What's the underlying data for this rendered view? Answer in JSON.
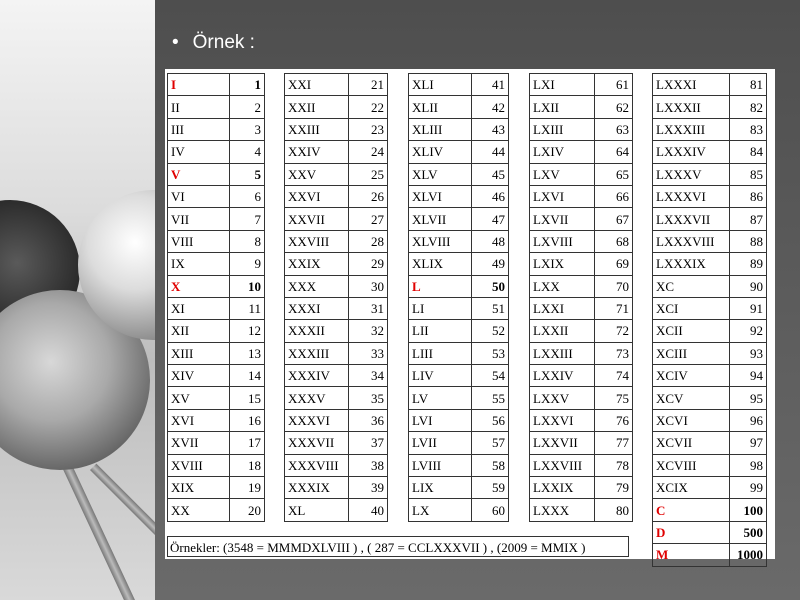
{
  "slide": {
    "bullet": "•",
    "heading": "Örnek :"
  },
  "groups": [
    {
      "rows": [
        [
          "I",
          "1"
        ],
        [
          "II",
          "2"
        ],
        [
          "III",
          "3"
        ],
        [
          "IV",
          "4"
        ],
        [
          "V",
          "5"
        ],
        [
          "VI",
          "6"
        ],
        [
          "VII",
          "7"
        ],
        [
          "VIII",
          "8"
        ],
        [
          "IX",
          "9"
        ],
        [
          "X",
          "10"
        ],
        [
          "XI",
          "11"
        ],
        [
          "XII",
          "12"
        ],
        [
          "XIII",
          "13"
        ],
        [
          "XIV",
          "14"
        ],
        [
          "XV",
          "15"
        ],
        [
          "XVI",
          "16"
        ],
        [
          "XVII",
          "17"
        ],
        [
          "XVIII",
          "18"
        ],
        [
          "XIX",
          "19"
        ],
        [
          "XX",
          "20"
        ]
      ]
    },
    {
      "rows": [
        [
          "XXI",
          "21"
        ],
        [
          "XXII",
          "22"
        ],
        [
          "XXIII",
          "23"
        ],
        [
          "XXIV",
          "24"
        ],
        [
          "XXV",
          "25"
        ],
        [
          "XXVI",
          "26"
        ],
        [
          "XXVII",
          "27"
        ],
        [
          "XXVIII",
          "28"
        ],
        [
          "XXIX",
          "29"
        ],
        [
          "XXX",
          "30"
        ],
        [
          "XXXI",
          "31"
        ],
        [
          "XXXII",
          "32"
        ],
        [
          "XXXIII",
          "33"
        ],
        [
          "XXXIV",
          "34"
        ],
        [
          "XXXV",
          "35"
        ],
        [
          "XXXVI",
          "36"
        ],
        [
          "XXXVII",
          "37"
        ],
        [
          "XXXVIII",
          "38"
        ],
        [
          "XXXIX",
          "39"
        ],
        [
          "XL",
          "40"
        ]
      ]
    },
    {
      "rows": [
        [
          "XLI",
          "41"
        ],
        [
          "XLII",
          "42"
        ],
        [
          "XLIII",
          "43"
        ],
        [
          "XLIV",
          "44"
        ],
        [
          "XLV",
          "45"
        ],
        [
          "XLVI",
          "46"
        ],
        [
          "XLVII",
          "47"
        ],
        [
          "XLVIII",
          "48"
        ],
        [
          "XLIX",
          "49"
        ],
        [
          "L",
          "50"
        ],
        [
          "LI",
          "51"
        ],
        [
          "LII",
          "52"
        ],
        [
          "LIII",
          "53"
        ],
        [
          "LIV",
          "54"
        ],
        [
          "LV",
          "55"
        ],
        [
          "LVI",
          "56"
        ],
        [
          "LVII",
          "57"
        ],
        [
          "LVIII",
          "58"
        ],
        [
          "LIX",
          "59"
        ],
        [
          "LX",
          "60"
        ]
      ]
    },
    {
      "rows": [
        [
          "LXI",
          "61"
        ],
        [
          "LXII",
          "62"
        ],
        [
          "LXIII",
          "63"
        ],
        [
          "LXIV",
          "64"
        ],
        [
          "LXV",
          "65"
        ],
        [
          "LXVI",
          "66"
        ],
        [
          "LXVII",
          "67"
        ],
        [
          "LXVIII",
          "68"
        ],
        [
          "LXIX",
          "69"
        ],
        [
          "LXX",
          "70"
        ],
        [
          "LXXI",
          "71"
        ],
        [
          "LXXII",
          "72"
        ],
        [
          "LXXIII",
          "73"
        ],
        [
          "LXXIV",
          "74"
        ],
        [
          "LXXV",
          "75"
        ],
        [
          "LXXVI",
          "76"
        ],
        [
          "LXXVII",
          "77"
        ],
        [
          "LXXVIII",
          "78"
        ],
        [
          "LXXIX",
          "79"
        ],
        [
          "LXXX",
          "80"
        ]
      ]
    },
    {
      "rows": [
        [
          "LXXXI",
          "81"
        ],
        [
          "LXXXII",
          "82"
        ],
        [
          "LXXXIII",
          "83"
        ],
        [
          "LXXXIV",
          "84"
        ],
        [
          "LXXXV",
          "85"
        ],
        [
          "LXXXVI",
          "86"
        ],
        [
          "LXXXVII",
          "87"
        ],
        [
          "LXXXVIII",
          "88"
        ],
        [
          "LXXXIX",
          "89"
        ],
        [
          "XC",
          "90"
        ],
        [
          "XCI",
          "91"
        ],
        [
          "XCII",
          "92"
        ],
        [
          "XCIII",
          "93"
        ],
        [
          "XCIV",
          "94"
        ],
        [
          "XCV",
          "95"
        ],
        [
          "XCVI",
          "96"
        ],
        [
          "XCVII",
          "97"
        ],
        [
          "XCVIII",
          "98"
        ],
        [
          "XCIX",
          "99"
        ],
        [
          "C",
          "100"
        ],
        [
          "D",
          "500"
        ],
        [
          "M",
          "1000"
        ]
      ]
    }
  ],
  "highlighted_numerals": [
    "I",
    "V",
    "X",
    "L",
    "C",
    "D",
    "M"
  ],
  "examples": "Örnekler: (3548 = MMMDXLVIII ) , ( 287 = CCLXXXVII ) , (2009 = MMIX )",
  "colors": {
    "highlight": "#e00000",
    "background": "#5a5a5a"
  }
}
